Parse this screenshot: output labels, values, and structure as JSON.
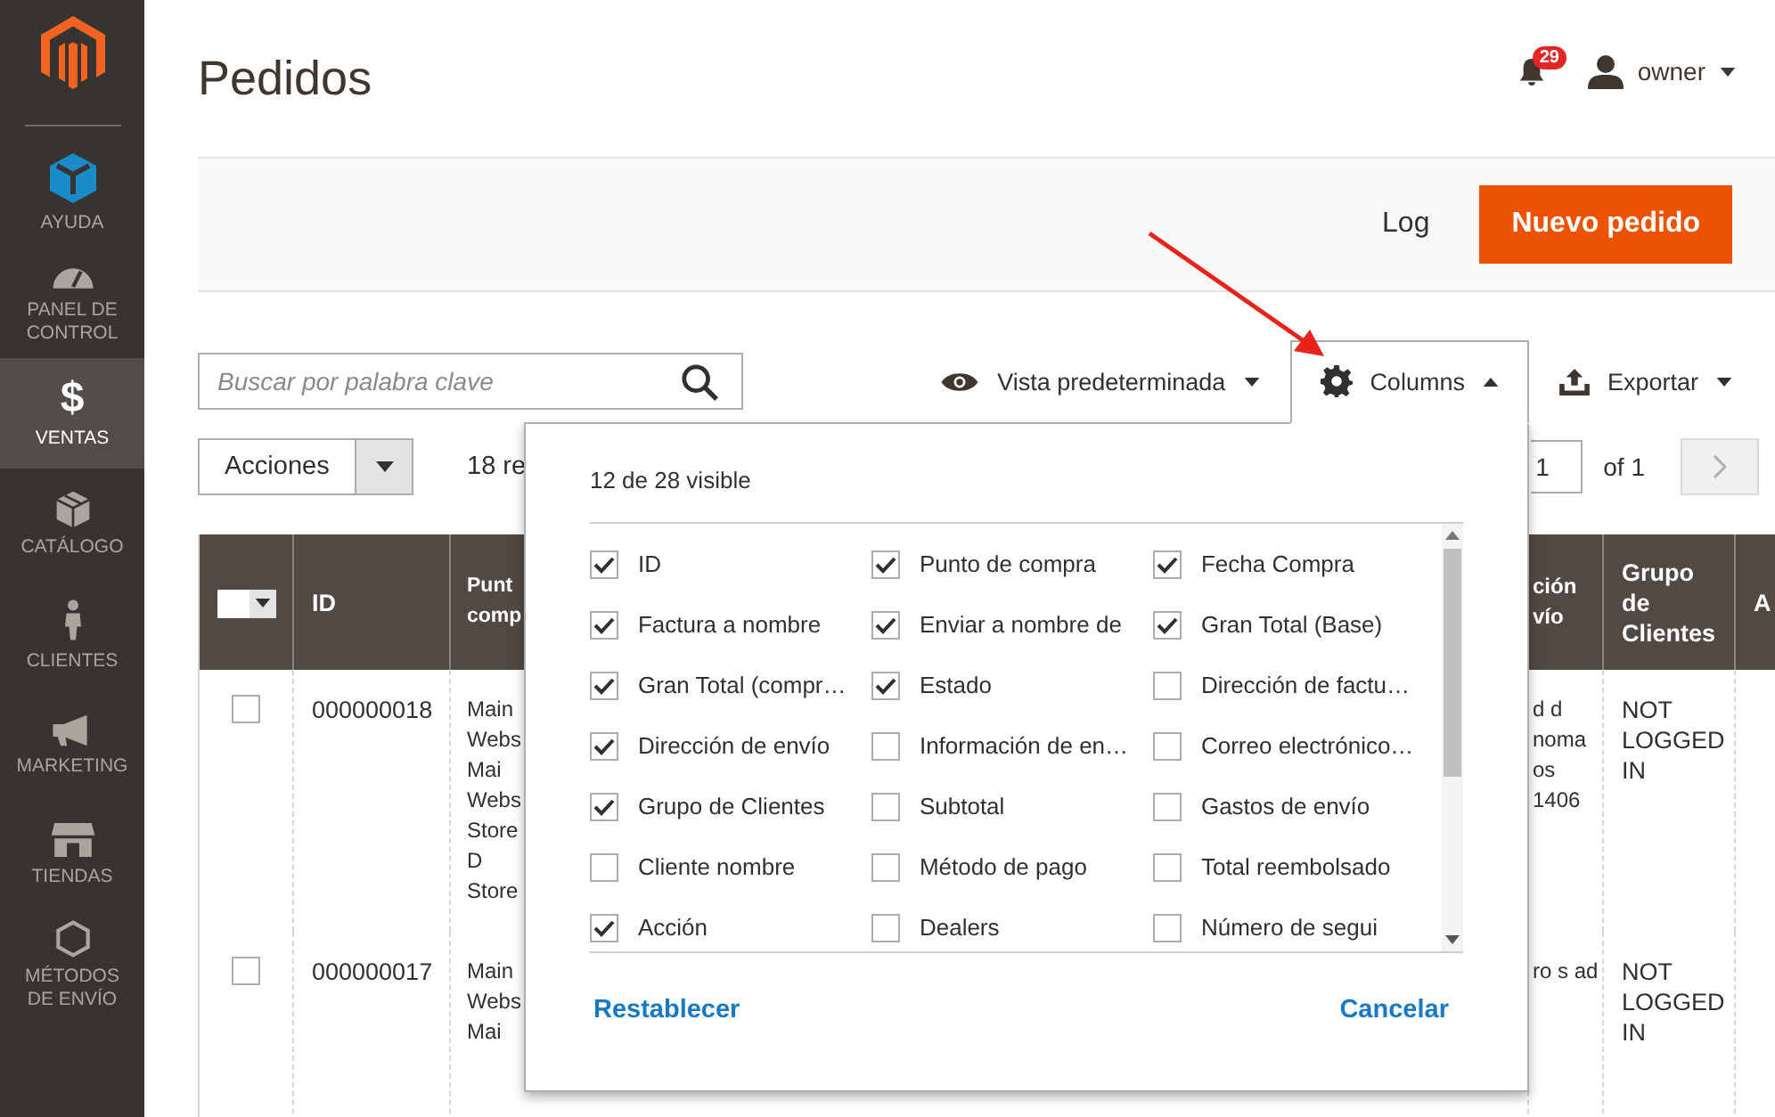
{
  "sidebar": {
    "items": [
      {
        "kind": "help",
        "label": "AYUDA",
        "selected": false
      },
      {
        "kind": "dashboard",
        "label": "PANEL DE CONTROL",
        "selected": false
      },
      {
        "kind": "sales",
        "label": "VENTAS",
        "glyph": "$",
        "selected": true
      },
      {
        "kind": "catalog",
        "label": "CATÁLOGO",
        "selected": false
      },
      {
        "kind": "customers",
        "label": "CLIENTES",
        "selected": false
      },
      {
        "kind": "marketing",
        "label": "MARKETING",
        "selected": false
      },
      {
        "kind": "stores",
        "label": "TIENDAS",
        "selected": false
      },
      {
        "kind": "shipping",
        "label": "MÉTODOS DE ENVÍO",
        "selected": false
      }
    ]
  },
  "header": {
    "title": "Pedidos",
    "notifications": "29",
    "user": "owner"
  },
  "action_bar": {
    "link": "Log",
    "primary_button": "Nuevo pedido"
  },
  "toolbar": {
    "search": {
      "placeholder": "Buscar por palabra clave"
    },
    "view": "Vista predeterminada",
    "columns_button": {
      "label": "Columns",
      "expanded": true
    },
    "export": "Exportar"
  },
  "grid_controls": {
    "actions": "Acciones",
    "records": "18 re",
    "page": "1",
    "page_total": "of 1"
  },
  "grid": {
    "mass_select": {
      "checked": false
    },
    "columns": [
      "ID",
      "Punt comp",
      "ción vío",
      "Grupo de Clientes",
      "A"
    ],
    "rows": [
      {
        "checked": false,
        "cells": [
          "000000018",
          "Main Webs Mai Webs Store D Store",
          "d d noma os 1406",
          "NOT LOGGED IN",
          ""
        ]
      },
      {
        "checked": false,
        "cells": [
          "000000017",
          "Main Webs Mai",
          "ro s ad",
          "NOT LOGGED IN",
          ""
        ]
      }
    ]
  },
  "columns_panel": {
    "summary": "12 de 28 visible",
    "options": [
      {
        "label": "ID",
        "checked": true
      },
      {
        "label": "Punto de compra",
        "checked": true
      },
      {
        "label": "Fecha Compra",
        "checked": true
      },
      {
        "label": "Factura a nombre",
        "checked": true
      },
      {
        "label": "Enviar a nombre de",
        "checked": true
      },
      {
        "label": "Gran Total (Base)",
        "checked": true
      },
      {
        "label": "Gran Total (compr…",
        "checked": true
      },
      {
        "label": "Estado",
        "checked": true
      },
      {
        "label": "Dirección de factu…",
        "checked": false
      },
      {
        "label": "Dirección de envío",
        "checked": true
      },
      {
        "label": "Información de en…",
        "checked": false
      },
      {
        "label": "Correo electrónico…",
        "checked": false
      },
      {
        "label": "Grupo de Clientes",
        "checked": true
      },
      {
        "label": "Subtotal",
        "checked": false
      },
      {
        "label": "Gastos de envío",
        "checked": false
      },
      {
        "label": "Cliente nombre",
        "checked": false
      },
      {
        "label": "Método de pago",
        "checked": false
      },
      {
        "label": "Total reembolsado",
        "checked": false
      },
      {
        "label": "Acción",
        "checked": true
      },
      {
        "label": "Dealers",
        "checked": false
      },
      {
        "label": "Número de segui",
        "checked": false
      }
    ],
    "reset": "Restablecer",
    "cancel": "Cancelar"
  }
}
